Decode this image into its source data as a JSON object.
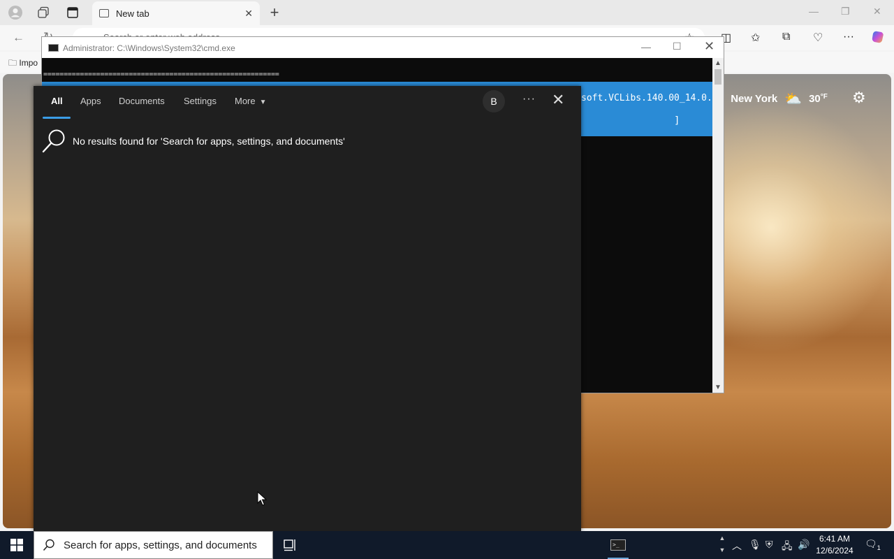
{
  "browser": {
    "tab_title": "New tab",
    "address_placeholder": "Search or enter web address",
    "favorites_item": "Impo",
    "weather": {
      "location": "New York",
      "city_fragment": "rk",
      "temperature": "30",
      "unit": "°F"
    }
  },
  "cmd": {
    "title": "Administrator: C:\\Windows\\System32\\cmd.exe",
    "separator": "==========================================================",
    "progress_text": "soft.VCLibs.140.00_14.0.",
    "progress_bracket": "]",
    "progress_color": "#2a8bd6"
  },
  "search_panel": {
    "tabs": [
      {
        "label": "All",
        "active": true
      },
      {
        "label": "Apps"
      },
      {
        "label": "Documents"
      },
      {
        "label": "Settings"
      },
      {
        "label": "More"
      }
    ],
    "avatar_letter": "B",
    "more_options": "···",
    "no_results": "No results found for 'Search for apps, settings, and documents'",
    "accent": "#3b9de6"
  },
  "taskbar": {
    "search_placeholder": "Search for apps, settings, and documents",
    "time": "6:41 AM",
    "date": "12/6/2024",
    "notification_count": "1"
  }
}
